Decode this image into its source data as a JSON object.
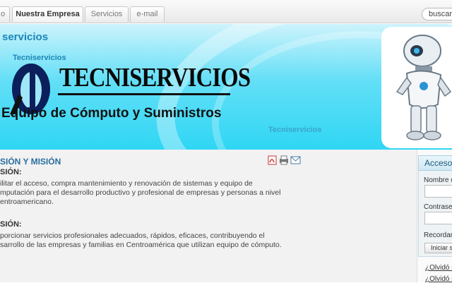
{
  "nav": {
    "tabs": [
      {
        "label": "o"
      },
      {
        "label": "Nuestra Empresa"
      },
      {
        "label": "Servicios"
      },
      {
        "label": "e-mail"
      }
    ],
    "search_label": "buscar..."
  },
  "banner": {
    "small_brand_1": "servicios",
    "small_brand_2": "Tecniservicios",
    "small_brand_3": "Tecniservicios",
    "logo_text": "TECNISERVICIOS",
    "slogan": "Equipo de Cómputo y Suministros"
  },
  "article": {
    "title": "SIÓN Y MISIÓN",
    "icons": [
      "pdf-icon",
      "print-icon",
      "email-icon"
    ],
    "vision_heading": "SIÓN:",
    "vision_lines": [
      "ilitar el acceso, compra mantenimiento y renovación  de sistemas y equipo de",
      "mputación para el desarrollo productivo y profesional de empresas y personas a nivel",
      "entroamericano."
    ],
    "mission_heading": "SIÓN:",
    "mission_lines": [
      "porcionar servicios profesionales adecuados, rápidos, eficaces, contribuyendo el",
      "sarrollo de las empresas y familias en Centroamérica que utilizan equipo de cómputo."
    ]
  },
  "sidebar": {
    "title": "Acceso",
    "username_label": "Nombre d",
    "password_label": "Contrase",
    "remember_label": "Recordar",
    "login_button": "Iniciar s",
    "forgot_password": "¿Olvidó s",
    "forgot_username": "¿Olvidó s"
  },
  "colors": {
    "accent": "#2a6e9e",
    "banner": "#2fd6f4"
  }
}
